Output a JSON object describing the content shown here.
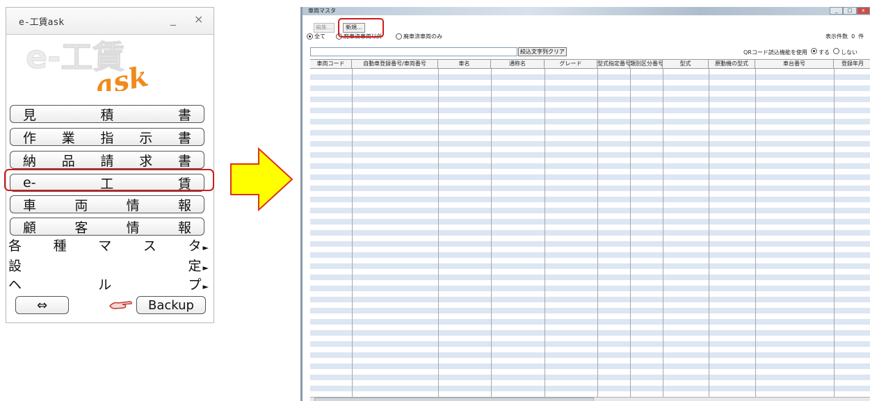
{
  "launcher": {
    "title": "e-工賃ask",
    "minimize": "_",
    "close": "×",
    "logo_main": "e-工賃",
    "logo_sub": "ask",
    "buttons": [
      {
        "chars": [
          "見",
          "積",
          "書"
        ]
      },
      {
        "chars": [
          "作",
          "業",
          "指",
          "示",
          "書"
        ]
      },
      {
        "chars": [
          "納",
          "品",
          "請",
          "求",
          "書"
        ]
      },
      {
        "chars": [
          "e-",
          "工",
          "賃"
        ]
      },
      {
        "chars": [
          "車",
          "両",
          "情",
          "報"
        ]
      },
      {
        "chars": [
          "顧",
          "客",
          "情",
          "報"
        ]
      }
    ],
    "menus": [
      {
        "chars": [
          "各",
          "種",
          "マ",
          "ス",
          "タ"
        ]
      },
      {
        "chars": [
          "設",
          "定"
        ]
      },
      {
        "chars": [
          "ヘ",
          "ル",
          "プ"
        ]
      }
    ],
    "swap_button": "⇔",
    "backup_button": "Backup",
    "highlight_color": "#d11a1a"
  },
  "arrow": {
    "fill": "#ffff00",
    "stroke": "#e0301e"
  },
  "vehicle_window": {
    "title": "車両マスタ",
    "edit_button": "編集…",
    "new_button": "新規…",
    "radio_all": "全て",
    "radio_exclude": "廃車済車両以外",
    "radio_only": "廃車済車両のみ",
    "count_label": "表示件数",
    "count_value": "0",
    "count_unit": "件",
    "clear_button": "絞込文字列クリア",
    "qr_label": "QRコード読込機能を使用",
    "qr_yes": "する",
    "qr_no": "しない",
    "columns": [
      "車両コード",
      "自動車登録番号/車両番号",
      "車名",
      "通称名",
      "グレード",
      "型式指定番号",
      "類別区分番号",
      "型式",
      "原動機の型式",
      "車台番号",
      "登録年月"
    ]
  }
}
